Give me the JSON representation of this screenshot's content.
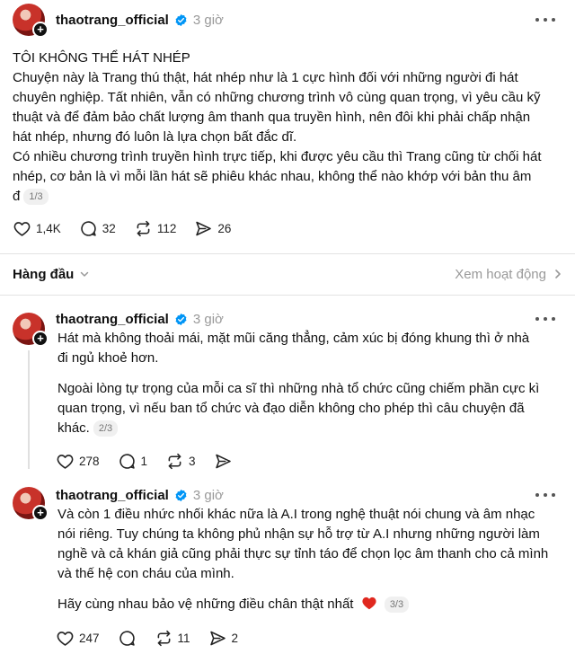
{
  "main_post": {
    "username": "thaotrang_official",
    "time": "3 giờ",
    "lines": [
      "TÔI KHÔNG THỂ HÁT NHÉP",
      "Chuyện này là Trang thú thật, hát nhép như là 1 cực hình đối với những người đi hát",
      "chuyên nghiệp. Tất nhiên, vẫn có những chương trình vô cùng quan trọng, vì yêu cầu kỹ",
      "thuật và để đảm bảo chất lượng âm thanh qua truyền hình, nên đôi khi phải chấp nhận",
      "hát nhép, nhưng đó luôn là lựa chọn bất đắc dĩ.",
      "Có nhiều chương trình truyền hình trực tiếp, khi được yêu cầu thì Trang cũng từ chối hát",
      "nhép, cơ bản là vì mỗi lần hát sẽ phiêu khác nhau, không thể nào khớp với bản thu âm",
      "đ"
    ],
    "pager": "1/3",
    "likes": "1,4K",
    "comments": "32",
    "reposts": "112",
    "shares": "26"
  },
  "sort": {
    "label": "Hàng đầu",
    "activity_link": "Xem hoạt động"
  },
  "reply1": {
    "username": "thaotrang_official",
    "time": "3 giờ",
    "para1": [
      "Hát mà không thoải mái, mặt mũi căng thẳng, cảm xúc bị đóng khung thì ở nhà",
      "đi ngủ khoẻ hơn."
    ],
    "para2": [
      "Ngoài lòng tự trọng của mỗi ca sĩ thì những nhà tổ chức cũng chiếm phần cực kì",
      "quan trọng, vì nếu ban tổ chức và đạo diễn không cho phép thì câu chuyện đã",
      "khác."
    ],
    "pager": "2/3",
    "likes": "278",
    "comments": "1",
    "reposts": "3"
  },
  "reply2": {
    "username": "thaotrang_official",
    "time": "3 giờ",
    "para1": [
      "Và còn 1 điều nhức nhối khác nữa là A.I trong nghệ thuật nói chung và âm nhạc",
      "nói riêng. Tuy chúng ta không phủ nhận sự hỗ trợ từ A.I nhưng những người làm",
      "nghề và cả khán giả cũng phải thực sự tỉnh táo để chọn lọc âm thanh cho cả mình",
      "và thế hệ con cháu của mình."
    ],
    "para2": "Hãy cùng nhau bảo vệ những điều chân thật nhất",
    "pager": "3/3",
    "likes": "247",
    "reposts": "11",
    "shares": "2"
  },
  "icons": {
    "verified": "verified-badge-icon",
    "more": "more-options-icon",
    "like": "heart-icon",
    "comment": "comment-icon",
    "repost": "repost-icon",
    "share": "share-icon",
    "chevron_down": "chevron-down-icon",
    "chevron_right": "chevron-right-icon",
    "emoji": "red-heart-emoji"
  },
  "colors": {
    "verified_blue": "#0095f6",
    "heart_red": "#e0281f",
    "muted_text": "#999999"
  }
}
